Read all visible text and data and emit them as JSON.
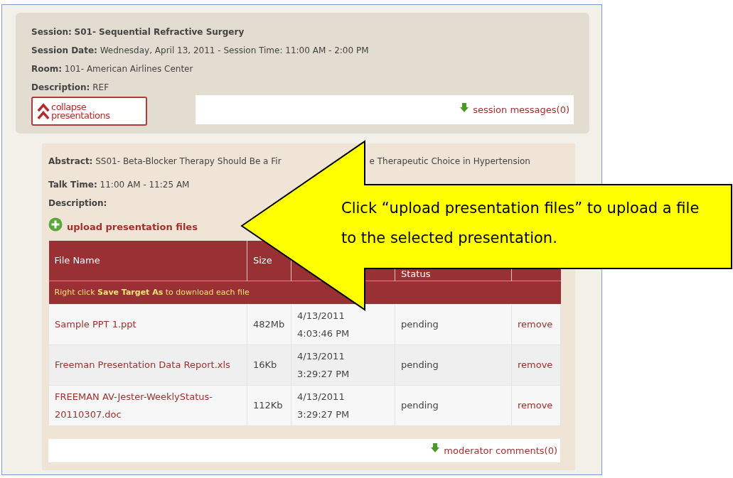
{
  "session": {
    "title_label": "Session:",
    "title": "S01- Sequential Refractive Surgery",
    "fields": [
      {
        "label": "Session Date:",
        "value": "Wednesday, April 13, 2011 - Session Time: 11:00 AM - 2:00 PM"
      },
      {
        "label": "Room:",
        "value": "101- American Airlines Center"
      },
      {
        "label": "Description:",
        "value": "REF"
      }
    ],
    "collapse_button": {
      "line1": "collapse",
      "line2": "presentations"
    },
    "messages_link": "session messages(0)"
  },
  "presentation": {
    "abstract_label": "Abstract:",
    "abstract_parts": [
      "SS01- Beta-Blocker Therapy Should Be a Fir",
      "e Therapeutic Choice in Hypertension"
    ],
    "talk_time_label": "Talk Time:",
    "talk_time": "11:00 AM - 11:25 AM",
    "description_label": "Description:",
    "upload_link": "upload presentation files",
    "table": {
      "columns": [
        "File Name",
        "Size",
        "",
        "Status",
        ""
      ],
      "note": "Right click **Save Target As** to download each file",
      "rows": [
        {
          "file": "Sample PPT 1.ppt",
          "size": "482Mb",
          "date": "4/13/2011",
          "time": "4:03:46 PM",
          "status": "pending",
          "action": "remove"
        },
        {
          "file": "Freeman Presentation Data Report.xls",
          "size": "16Kb",
          "date": "4/13/2011",
          "time": "3:29:27 PM",
          "status": "pending",
          "action": "remove"
        },
        {
          "file": "FREEMAN AV-Jester-WeeklyStatus-20110307.doc",
          "size": "112Kb",
          "date": "4/13/2011",
          "time": "3:29:27 PM",
          "status": "pending",
          "action": "remove"
        }
      ]
    },
    "comments_link": "moderator comments(0)"
  },
  "callout": {
    "text": "Click “upload presentation files” to upload a file to the selected presentation."
  }
}
